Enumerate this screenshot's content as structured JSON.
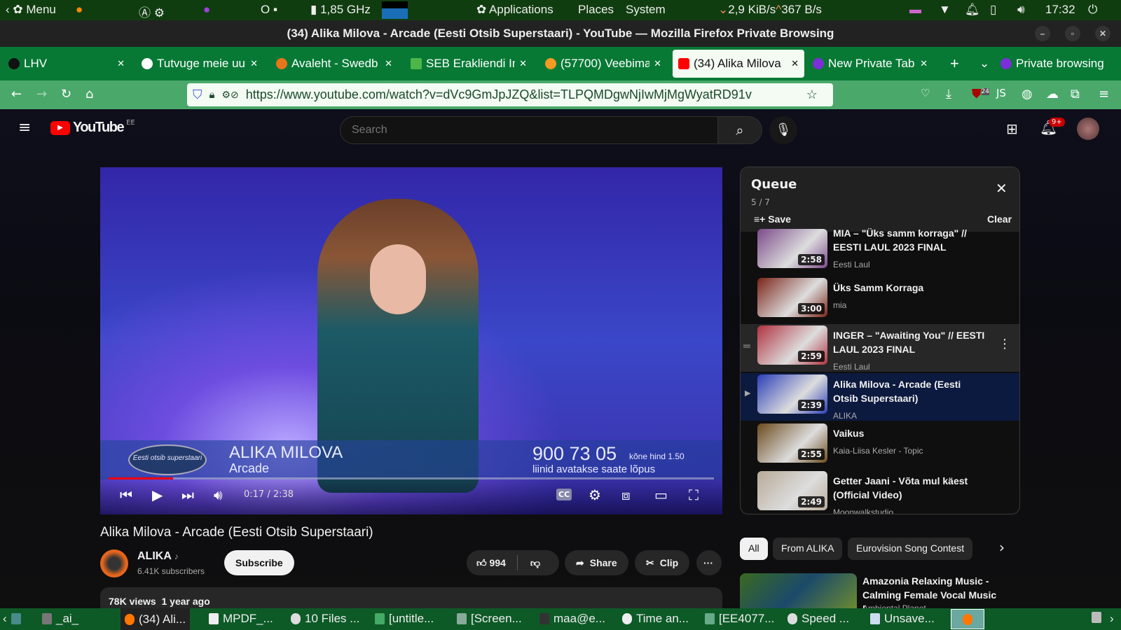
{
  "system_panel": {
    "menu": "Menu",
    "cpu": "1,85 GHz",
    "applications": "Applications",
    "places": "Places",
    "system": "System",
    "net_down": "2,9 KiB/s",
    "net_up": "367 B/s",
    "clock": "17:32"
  },
  "window": {
    "title": "(34) Alika Milova - Arcade (Eesti Otsib Superstaari) - YouTube — Mozilla Firefox Private Browsing"
  },
  "tabs": [
    {
      "label": "LHV",
      "color": "#111"
    },
    {
      "label": "Tutvuge meie uu",
      "color": "#fff"
    },
    {
      "label": "Avaleht - Swedb",
      "color": "#e8741c"
    },
    {
      "label": "SEB Erakliendi In",
      "color": "#4cb648"
    },
    {
      "label": "(57700) Veebima",
      "color": "#f59a23"
    },
    {
      "label": "(34) Alika Milova",
      "color": "#f00"
    },
    {
      "label": "New Private Tab",
      "color": "#7b2fd8"
    }
  ],
  "private_label": "Private browsing",
  "url": "https://www.youtube.com/watch?v=dVc9GmJpJZQ&list=TLPQMDgwNjIwMjMgWyatRD91v",
  "extension_badge": "24",
  "youtube": {
    "logo": "YouTube",
    "region": "EE",
    "search_placeholder": "Search",
    "notif_count": "9+"
  },
  "player": {
    "overlay_name": "ALIKA MILOVA",
    "overlay_song": "Arcade",
    "overlay_phone": "900 73 05",
    "overlay_price": "kõne hind 1.50",
    "overlay_note": "liinid avatakse saate lõpus",
    "overlay_logo": "Eesti otsib superstaari",
    "time": "0:17 / 2:38",
    "progress": 0.107,
    "cc": "CC"
  },
  "video": {
    "title": "Alika Milova - Arcade (Eesti Otsib Superstaari)",
    "channel": "ALIKA",
    "subscribers": "6.41K subscribers",
    "subscribe": "Subscribe",
    "likes": "994",
    "share": "Share",
    "clip": "Clip",
    "views": "78K views",
    "age": "1 year ago"
  },
  "queue": {
    "title": "Queue",
    "position": "5 / 7",
    "save": "Save",
    "clear": "Clear",
    "items": [
      {
        "title": "MIA – \"Üks samm korraga\" // EESTI LAUL 2023 FINAL",
        "channel": "Eesti Laul",
        "duration": "2:58",
        "color": "#7b4a8a"
      },
      {
        "title": "Üks Samm Korraga",
        "channel": "mia",
        "duration": "3:00",
        "color": "#7a2418"
      },
      {
        "title": "INGER – \"Awaiting You\" // EESTI LAUL 2023 FINAL",
        "channel": "Eesti Laul",
        "duration": "2:59",
        "color": "#b0323f"
      },
      {
        "title": "Alika Milova - Arcade (Eesti Otsib Superstaari)",
        "channel": "ALIKA",
        "duration": "2:39",
        "color": "#2b3fb8"
      },
      {
        "title": "Vaikus",
        "channel": "Kaia-Liisa Kesler - Topic",
        "duration": "2:55",
        "color": "#6b4a1c"
      },
      {
        "title": "Getter Jaani - Võta mul käest (Official Video)",
        "channel": "Moonwalkstudio",
        "duration": "2:49",
        "color": "#b8aa98"
      }
    ]
  },
  "chips": [
    "All",
    "From ALIKA",
    "Eurovision Song Contest"
  ],
  "recommended": {
    "title": "Amazonia Relaxing Music - Calming Female Vocal Music |...",
    "channel": "Ambiental Planet"
  },
  "taskbar": [
    "_ai_",
    "(34) Ali...",
    "MPDF_...",
    "10 Files ...",
    "[untitle...",
    "[Screen...",
    "maa@e...",
    "Time an...",
    "[EE4077...",
    "Speed ...",
    "Unsave..."
  ]
}
